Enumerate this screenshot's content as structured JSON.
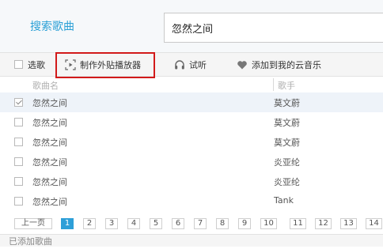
{
  "search": {
    "label": "搜索歌曲",
    "value": "忽然之间"
  },
  "toolbar": {
    "select_label": "选歌",
    "make_player_label": "制作外贴播放器",
    "listen_label": "试听",
    "add_label": "添加到我的云音乐"
  },
  "headers": {
    "title": "歌曲名",
    "artist": "歌手"
  },
  "rows": [
    {
      "title": "忽然之间",
      "artist": "莫文蔚",
      "checked": true
    },
    {
      "title": "忽然之间",
      "artist": "莫文蔚",
      "checked": false
    },
    {
      "title": "忽然之间",
      "artist": "莫文蔚",
      "checked": false
    },
    {
      "title": "忽然之间",
      "artist": "炎亚纶",
      "checked": false
    },
    {
      "title": "忽然之间",
      "artist": "炎亚纶",
      "checked": false
    },
    {
      "title": "忽然之间",
      "artist": "Tank",
      "checked": false
    }
  ],
  "pager": {
    "prev_label": "上一页",
    "pages": [
      "1",
      "2",
      "3",
      "4",
      "5",
      "6",
      "7",
      "8",
      "9",
      "10",
      "11",
      "12",
      "13",
      "14"
    ],
    "current": "1"
  },
  "footer": {
    "label": "已添加歌曲"
  },
  "colors": {
    "accent": "#2ca0d6",
    "highlight_border": "#d21a1a"
  }
}
